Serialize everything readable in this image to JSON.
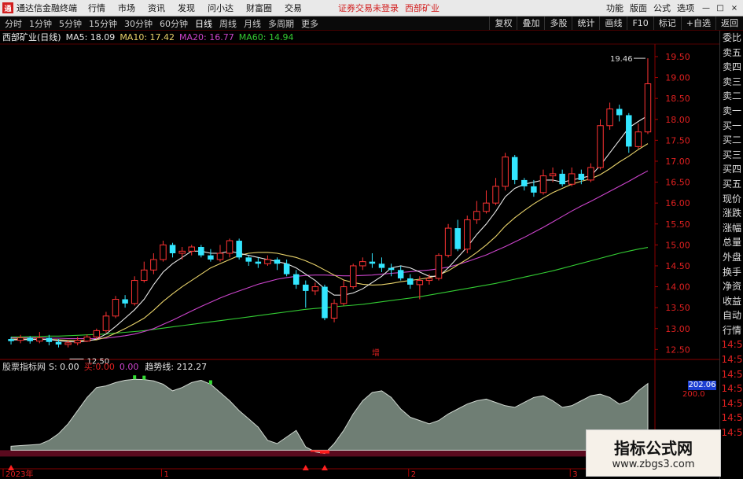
{
  "topbar": {
    "title": "通达信金融终端",
    "menu": [
      "行情",
      "市场",
      "资讯",
      "发现",
      "问小达",
      "财富圈",
      "交易"
    ],
    "alert": "证券交易未登录",
    "stock": "西部矿业",
    "right_menu": [
      "功能",
      "版面",
      "公式",
      "选项"
    ],
    "win": [
      "—",
      "□",
      "×"
    ]
  },
  "toolbar": {
    "periods": [
      "分时",
      "1分钟",
      "5分钟",
      "15分钟",
      "30分钟",
      "60分钟",
      "日线",
      "周线",
      "月线",
      "多周期",
      "更多"
    ],
    "right_buttons": [
      "复权",
      "叠加",
      "多股",
      "统计",
      "画线",
      "F10",
      "标记",
      "+自选",
      "返回"
    ]
  },
  "info": {
    "stock_name": "西部矿业(日线)",
    "ma5": "MA5: 18.09",
    "ma10": "MA10: 17.42",
    "ma20": "MA20: 16.77",
    "ma60": "MA60: 14.94",
    "colors": {
      "ma5": "#e8e8e8",
      "ma10": "#e8d26a",
      "ma20": "#cc44cc",
      "ma60": "#33cc33",
      "up": "#ff3333",
      "down": "#33e6ff"
    }
  },
  "price_axis": [
    "19.50",
    "19.00",
    "18.50",
    "18.00",
    "17.50",
    "17.00",
    "16.50",
    "16.00",
    "15.50",
    "15.00",
    "14.50",
    "14.00",
    "13.50",
    "13.00",
    "12.50"
  ],
  "annotations": {
    "high": "19.46",
    "low": "12.50",
    "mid": "增"
  },
  "right_panel": [
    "委比",
    "卖五",
    "卖四",
    "卖三",
    "卖二",
    "卖一",
    "买一",
    "买二",
    "买三",
    "买四",
    "买五",
    "现价",
    "涨跌",
    "涨幅",
    "总量",
    "外盘",
    "换手",
    "净资",
    "收益",
    "自动",
    "行情",
    "14:5",
    "14:5",
    "14:5",
    "14:5",
    "14:5",
    "14:5",
    "14:5"
  ],
  "indicator": {
    "name": "股票指标网",
    "s": "S: 0.00",
    "b_label": "买: ",
    "b_val": "0.00",
    "c_val": "0.00",
    "trend": "趋势线: 212.27",
    "box_value": "202.06",
    "axis": [
      "200.0"
    ]
  },
  "time_axis": [
    "2023年",
    "1",
    "2",
    "3"
  ],
  "watermark": {
    "line1": "指标公式网",
    "line2": "www.zbgs3.com"
  },
  "chart_data": {
    "type": "candlestick",
    "price_range": [
      12.3,
      19.8
    ],
    "candles": [
      [
        12.75,
        12.7,
        12.8,
        12.62
      ],
      [
        12.72,
        12.78,
        12.85,
        12.65
      ],
      [
        12.78,
        12.7,
        12.82,
        12.64
      ],
      [
        12.7,
        12.78,
        12.92,
        12.65
      ],
      [
        12.78,
        12.68,
        12.85,
        12.6
      ],
      [
        12.68,
        12.62,
        12.75,
        12.55
      ],
      [
        12.62,
        12.66,
        12.72,
        12.55
      ],
      [
        12.66,
        12.72,
        12.8,
        12.6
      ],
      [
        12.7,
        12.8,
        12.86,
        12.68
      ],
      [
        12.8,
        12.95,
        13.0,
        12.75
      ],
      [
        12.95,
        13.3,
        13.4,
        12.9
      ],
      [
        13.3,
        13.7,
        13.78,
        13.25
      ],
      [
        13.7,
        13.6,
        13.8,
        13.5
      ],
      [
        13.6,
        14.15,
        14.25,
        13.55
      ],
      [
        14.15,
        14.4,
        14.6,
        14.1
      ],
      [
        14.4,
        14.65,
        14.8,
        14.3
      ],
      [
        14.65,
        15.0,
        15.1,
        14.6
      ],
      [
        15.0,
        14.8,
        15.05,
        14.7
      ],
      [
        14.8,
        14.85,
        14.95,
        14.65
      ],
      [
        14.85,
        14.95,
        15.0,
        14.75
      ],
      [
        14.95,
        14.75,
        15.0,
        14.7
      ],
      [
        14.75,
        14.65,
        14.9,
        14.6
      ],
      [
        14.65,
        14.8,
        15.0,
        14.6
      ],
      [
        14.8,
        15.1,
        15.15,
        14.7
      ],
      [
        15.1,
        14.7,
        15.15,
        14.65
      ],
      [
        14.7,
        14.6,
        14.75,
        14.5
      ],
      [
        14.6,
        14.55,
        14.7,
        14.45
      ],
      [
        14.55,
        14.65,
        14.75,
        14.5
      ],
      [
        14.65,
        14.55,
        14.7,
        14.4
      ],
      [
        14.55,
        14.3,
        14.65,
        14.25
      ],
      [
        14.3,
        14.05,
        14.4,
        13.95
      ],
      [
        14.05,
        13.9,
        14.15,
        13.5
      ],
      [
        13.9,
        14.0,
        14.1,
        13.8
      ],
      [
        14.0,
        13.25,
        14.05,
        13.2
      ],
      [
        13.25,
        13.6,
        13.7,
        13.15
      ],
      [
        13.6,
        14.0,
        14.15,
        13.55
      ],
      [
        14.0,
        14.5,
        14.55,
        13.95
      ],
      [
        14.5,
        14.6,
        14.7,
        14.4
      ],
      [
        14.6,
        14.55,
        14.8,
        14.45
      ],
      [
        14.55,
        14.45,
        14.7,
        14.35
      ],
      [
        14.45,
        14.4,
        14.55,
        14.25
      ],
      [
        14.4,
        14.2,
        14.5,
        14.15
      ],
      [
        14.2,
        14.05,
        14.3,
        13.95
      ],
      [
        14.05,
        14.15,
        14.25,
        13.7
      ],
      [
        14.15,
        14.2,
        14.3,
        14.05
      ],
      [
        14.2,
        14.75,
        14.8,
        14.15
      ],
      [
        14.75,
        15.4,
        15.5,
        14.7
      ],
      [
        15.4,
        14.9,
        15.6,
        14.85
      ],
      [
        14.9,
        15.6,
        15.7,
        14.8
      ],
      [
        15.6,
        15.8,
        16.05,
        15.5
      ],
      [
        15.8,
        16.0,
        16.3,
        15.75
      ],
      [
        16.0,
        16.4,
        16.6,
        15.95
      ],
      [
        16.4,
        17.1,
        17.2,
        16.3
      ],
      [
        17.1,
        16.55,
        17.15,
        16.45
      ],
      [
        16.55,
        16.4,
        16.6,
        16.3
      ],
      [
        16.4,
        16.25,
        16.55,
        16.15
      ],
      [
        16.25,
        16.65,
        16.8,
        16.2
      ],
      [
        16.65,
        16.7,
        16.85,
        16.5
      ],
      [
        16.7,
        16.45,
        16.8,
        16.4
      ],
      [
        16.45,
        16.7,
        16.85,
        16.4
      ],
      [
        16.7,
        16.55,
        16.8,
        16.45
      ],
      [
        16.55,
        16.85,
        16.95,
        16.5
      ],
      [
        16.85,
        17.85,
        18.0,
        16.8
      ],
      [
        17.85,
        18.25,
        18.4,
        17.75
      ],
      [
        18.25,
        18.1,
        18.35,
        17.95
      ],
      [
        18.1,
        17.35,
        18.15,
        17.2
      ],
      [
        17.35,
        17.7,
        17.9,
        17.3
      ],
      [
        17.7,
        18.85,
        19.46,
        17.65
      ]
    ],
    "ma5": [
      12.73,
      12.73,
      12.74,
      12.74,
      12.74,
      12.71,
      12.69,
      12.68,
      12.7,
      12.75,
      12.87,
      13.05,
      13.25,
      13.45,
      13.7,
      14.05,
      14.35,
      14.55,
      14.7,
      14.85,
      14.85,
      14.8,
      14.8,
      14.85,
      14.8,
      14.75,
      14.7,
      14.65,
      14.6,
      14.55,
      14.45,
      14.3,
      14.15,
      13.95,
      13.8,
      13.8,
      13.85,
      13.95,
      14.1,
      14.25,
      14.45,
      14.5,
      14.45,
      14.35,
      14.25,
      14.25,
      14.45,
      14.7,
      14.95,
      15.25,
      15.5,
      15.8,
      16.15,
      16.35,
      16.45,
      16.5,
      16.55,
      16.55,
      16.5,
      16.55,
      16.6,
      16.65,
      16.9,
      17.2,
      17.5,
      17.8,
      17.95,
      18.09
    ],
    "ma10": [
      12.75,
      12.75,
      12.75,
      12.75,
      12.74,
      12.73,
      12.72,
      12.72,
      12.72,
      12.73,
      12.79,
      12.89,
      13.0,
      13.12,
      13.25,
      13.44,
      13.65,
      13.83,
      14.0,
      14.15,
      14.3,
      14.45,
      14.55,
      14.65,
      14.75,
      14.8,
      14.82,
      14.82,
      14.8,
      14.75,
      14.7,
      14.62,
      14.52,
      14.4,
      14.28,
      14.16,
      14.1,
      14.06,
      14.04,
      14.05,
      14.08,
      14.12,
      14.15,
      14.18,
      14.22,
      14.28,
      14.38,
      14.52,
      14.66,
      14.82,
      15.0,
      15.2,
      15.45,
      15.65,
      15.82,
      15.98,
      16.12,
      16.25,
      16.35,
      16.45,
      16.52,
      16.58,
      16.68,
      16.82,
      16.98,
      17.12,
      17.28,
      17.42
    ],
    "ma20": [
      12.78,
      12.78,
      12.78,
      12.78,
      12.77,
      12.77,
      12.76,
      12.76,
      12.76,
      12.76,
      12.77,
      12.8,
      12.83,
      12.87,
      12.93,
      13.0,
      13.1,
      13.2,
      13.31,
      13.42,
      13.53,
      13.63,
      13.73,
      13.82,
      13.9,
      13.98,
      14.06,
      14.12,
      14.18,
      14.22,
      14.25,
      14.27,
      14.28,
      14.28,
      14.27,
      14.26,
      14.26,
      14.27,
      14.28,
      14.3,
      14.32,
      14.34,
      14.36,
      14.38,
      14.4,
      14.43,
      14.47,
      14.53,
      14.6,
      14.68,
      14.76,
      14.86,
      14.96,
      15.07,
      15.18,
      15.3,
      15.42,
      15.55,
      15.68,
      15.81,
      15.93,
      16.04,
      16.16,
      16.28,
      16.4,
      16.52,
      16.65,
      16.77
    ],
    "ma60": [
      12.8,
      12.8,
      12.81,
      12.81,
      12.82,
      12.82,
      12.83,
      12.84,
      12.85,
      12.86,
      12.87,
      12.89,
      12.91,
      12.93,
      12.95,
      12.98,
      13.01,
      13.04,
      13.07,
      13.1,
      13.13,
      13.16,
      13.19,
      13.22,
      13.25,
      13.28,
      13.31,
      13.34,
      13.37,
      13.4,
      13.43,
      13.46,
      13.48,
      13.5,
      13.52,
      13.54,
      13.56,
      13.58,
      13.61,
      13.64,
      13.67,
      13.7,
      13.73,
      13.76,
      13.8,
      13.84,
      13.88,
      13.92,
      13.96,
      14.0,
      14.04,
      14.08,
      14.13,
      14.18,
      14.23,
      14.28,
      14.33,
      14.38,
      14.44,
      14.5,
      14.56,
      14.62,
      14.68,
      14.74,
      14.8,
      14.85,
      14.9,
      14.94
    ],
    "indicator_values": [
      12,
      14,
      16,
      18,
      30,
      50,
      80,
      120,
      160,
      190,
      195,
      205,
      212,
      215,
      214,
      210,
      200,
      180,
      190,
      205,
      212,
      200,
      175,
      150,
      120,
      95,
      70,
      30,
      20,
      40,
      60,
      10,
      -5,
      -10,
      20,
      60,
      110,
      150,
      175,
      180,
      160,
      125,
      100,
      90,
      80,
      90,
      110,
      125,
      140,
      150,
      155,
      145,
      135,
      130,
      145,
      160,
      165,
      150,
      130,
      135,
      150,
      165,
      170,
      160,
      140,
      150,
      180,
      202.06
    ],
    "indicator_range": [
      -30,
      225
    ]
  }
}
